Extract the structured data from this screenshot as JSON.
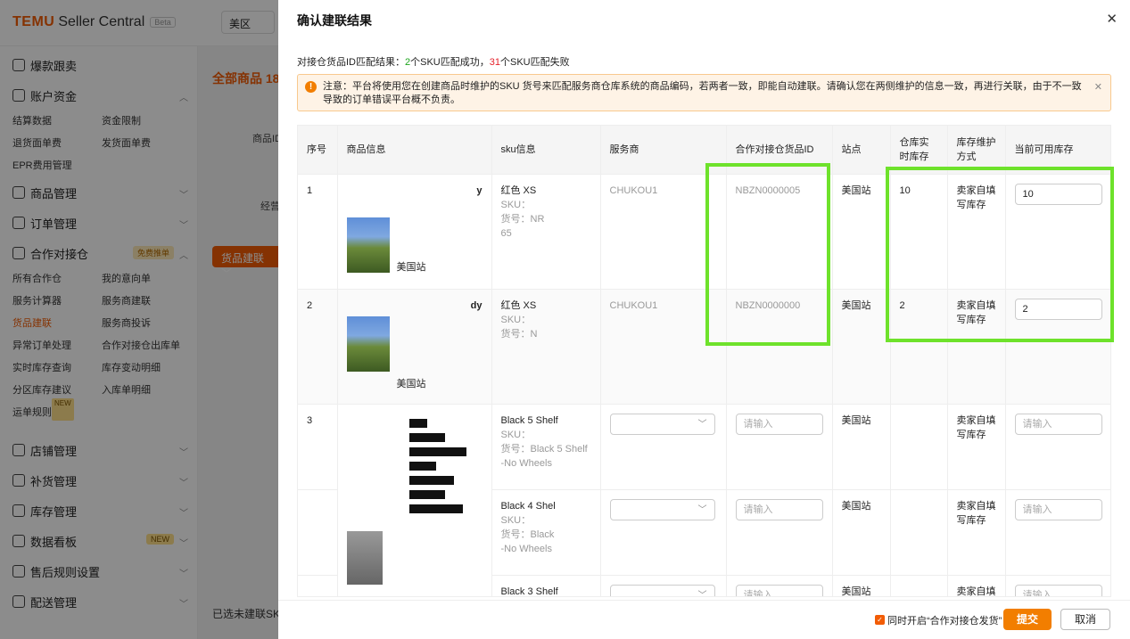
{
  "app": {
    "logo_temu": "TEMU",
    "logo_sc": "Seller Central",
    "logo_beta": "Beta",
    "region": "美区",
    "main_title": "全部商品 18",
    "label_product_id": "商品ID",
    "label_jy": "经营",
    "action_button": "货品建联",
    "bottom_text": "已选未建联SK"
  },
  "sidebar": {
    "g1": "爆款跟卖",
    "g2": "账户资金",
    "g2_items": [
      "结算数据",
      "资金限制",
      "退货面单费",
      "发货面单费",
      "EPR费用管理"
    ],
    "g3": "商品管理",
    "g4": "订单管理",
    "g5": "合作对接仓",
    "g5_badge": "免费推单",
    "g5_items": [
      "所有合作仓",
      "我的意向单",
      "服务计算器",
      "服务商建联",
      "货品建联",
      "服务商投诉",
      "异常订单处理",
      "合作对接仓出库单",
      "实时库存查询",
      "库存变动明细",
      "分区库存建议",
      "入库单明细",
      "运单规则配置"
    ],
    "new_tag": "NEW",
    "g6": "店铺管理",
    "g7": "补货管理",
    "g8": "库存管理",
    "g9": "数据看板",
    "g9_badge": "NEW",
    "g10": "售后规则设置",
    "g11": "配送管理"
  },
  "modal": {
    "title": "确认建联结果",
    "summary_prefix": "对接仓货品ID匹配结果：",
    "summary_ok_count": "2",
    "summary_ok_text": "个SKU匹配成功，",
    "summary_fail_count": "31",
    "summary_fail_text": "个SKU匹配失败",
    "notice": "注意：平台将使用您在创建商品时维护的SKU 货号来匹配服务商仓库系统的商品编码，若两者一致，即能自动建联。请确认您在两侧维护的信息一致，再进行关联，由于不一致导致的订单错误平台概不负责。",
    "columns": [
      "序号",
      "商品信息",
      "sku信息",
      "服务商",
      "合作对接仓货品ID",
      "站点",
      "仓库实时库存",
      "库存维护方式",
      "当前可用库存"
    ],
    "rows": [
      {
        "index": "1",
        "product_partial": "y",
        "site_label": "美国站",
        "sku_head": "红色 XS",
        "sku_line": "SKU：",
        "huohao": "货号：NR",
        "huohao2": "65",
        "provider": "CHUKOU1",
        "warehouse_id": "NBZN0000005",
        "site": "美国站",
        "realtime_stock": "10",
        "method": "卖家自填写库存",
        "available": "10"
      },
      {
        "index": "2",
        "product_partial": "dy",
        "site_label": "美国站",
        "sku_head": "红色 XS",
        "sku_line": "SKU：",
        "huohao": "货号：N",
        "huohao2": "",
        "provider": "CHUKOU1",
        "warehouse_id": "NBZN0000000",
        "site": "美国站",
        "realtime_stock": "2",
        "method": "卖家自填写库存",
        "available": "2"
      },
      {
        "index": "3",
        "sku_head": "Black 5 Shelf",
        "sku_line": "SKU：",
        "huohao": "货号：Black 5 Shelf",
        "huohao2": "-No Wheels",
        "provider": "",
        "warehouse_placeholder": "请输入",
        "site": "美国站",
        "method": "卖家自填写库存",
        "available_placeholder": "请输入"
      },
      {
        "index": "",
        "sku_head": "Black 4 Shel",
        "sku_line": "SKU：",
        "huohao": "货号：Black",
        "huohao2": "-No Wheels",
        "provider": "",
        "warehouse_placeholder": "请输入",
        "site": "美国站",
        "method": "卖家自填写库存",
        "available_placeholder": "请输入"
      },
      {
        "index": "",
        "sku_head": "Black 3 Shelf",
        "sku_line": "",
        "huohao": "",
        "huohao2": "",
        "provider": "",
        "warehouse_placeholder": "请输入",
        "site": "美国站",
        "method": "卖家自填",
        "available_placeholder": "请输入"
      }
    ],
    "footer": {
      "checkbox_label": "同时开启“合作对接仓发货”",
      "submit": "提交",
      "cancel": "取消"
    }
  }
}
